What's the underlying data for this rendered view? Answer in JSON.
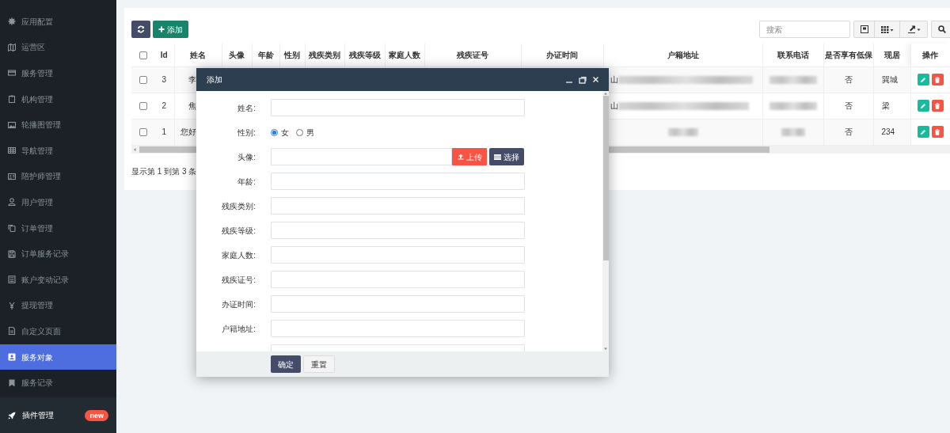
{
  "sidebar": {
    "items": [
      {
        "label": "应用配置",
        "selected": false
      },
      {
        "label": "运营区",
        "selected": false
      },
      {
        "label": "服务管理",
        "selected": false
      },
      {
        "label": "机构管理",
        "selected": false
      },
      {
        "label": "轮播图管理",
        "selected": false
      },
      {
        "label": "导航管理",
        "selected": false
      },
      {
        "label": "陪护师管理",
        "selected": false
      },
      {
        "label": "用户管理",
        "selected": false
      },
      {
        "label": "订单管理",
        "selected": false
      },
      {
        "label": "订单服务记录",
        "selected": false
      },
      {
        "label": "账户变动记录",
        "selected": false
      },
      {
        "label": "提现管理",
        "selected": false
      },
      {
        "label": "自定义页面",
        "selected": false
      },
      {
        "label": "服务对象",
        "selected": true
      },
      {
        "label": "服务记录",
        "selected": false
      }
    ],
    "plugin": {
      "label": "插件管理",
      "badge": "new"
    }
  },
  "toolbar": {
    "add_label": "添加",
    "search": {
      "placeholder": "搜索"
    }
  },
  "table": {
    "all_checked": false,
    "columns": [
      "Id",
      "姓名",
      "头像",
      "年龄",
      "性别",
      "残疾类别",
      "残疾等级",
      "家庭人数",
      "残疾证号",
      "办证时间",
      "户籍地址",
      "联系电话",
      "是否享有低保",
      "现居",
      "操作"
    ],
    "rows": [
      {
        "checked": false,
        "id": "3",
        "name": "李",
        "address": "山",
        "low_income": "否",
        "residence": "巽城"
      },
      {
        "checked": false,
        "id": "2",
        "name": "焦",
        "address": "山",
        "low_income": "否",
        "residence": "梁"
      },
      {
        "checked": false,
        "id": "1",
        "name": "您好",
        "low_income": "否",
        "residence": "234"
      }
    ]
  },
  "footer": "显示第 1 到第 3 条",
  "modal": {
    "title": "添加",
    "fields": [
      {
        "kind": "text",
        "label": "姓名:"
      },
      {
        "kind": "radio",
        "label": "性别:",
        "options": [
          {
            "label": "女",
            "selected": true
          },
          {
            "label": "男",
            "selected": false
          }
        ]
      },
      {
        "kind": "upload",
        "label": "头像:",
        "upload_label": "上传",
        "choose_label": "选择"
      },
      {
        "kind": "text",
        "label": "年龄:"
      },
      {
        "kind": "text",
        "label": "残疾类别:"
      },
      {
        "kind": "text",
        "label": "残疾等级:"
      },
      {
        "kind": "text",
        "label": "家庭人数:"
      },
      {
        "kind": "text",
        "label": "残疾证号:"
      },
      {
        "kind": "text",
        "label": "办证时间:"
      },
      {
        "kind": "text",
        "label": "户籍地址:"
      },
      {
        "kind": "text"
      }
    ],
    "buttons": [
      "确定",
      "重置"
    ]
  }
}
